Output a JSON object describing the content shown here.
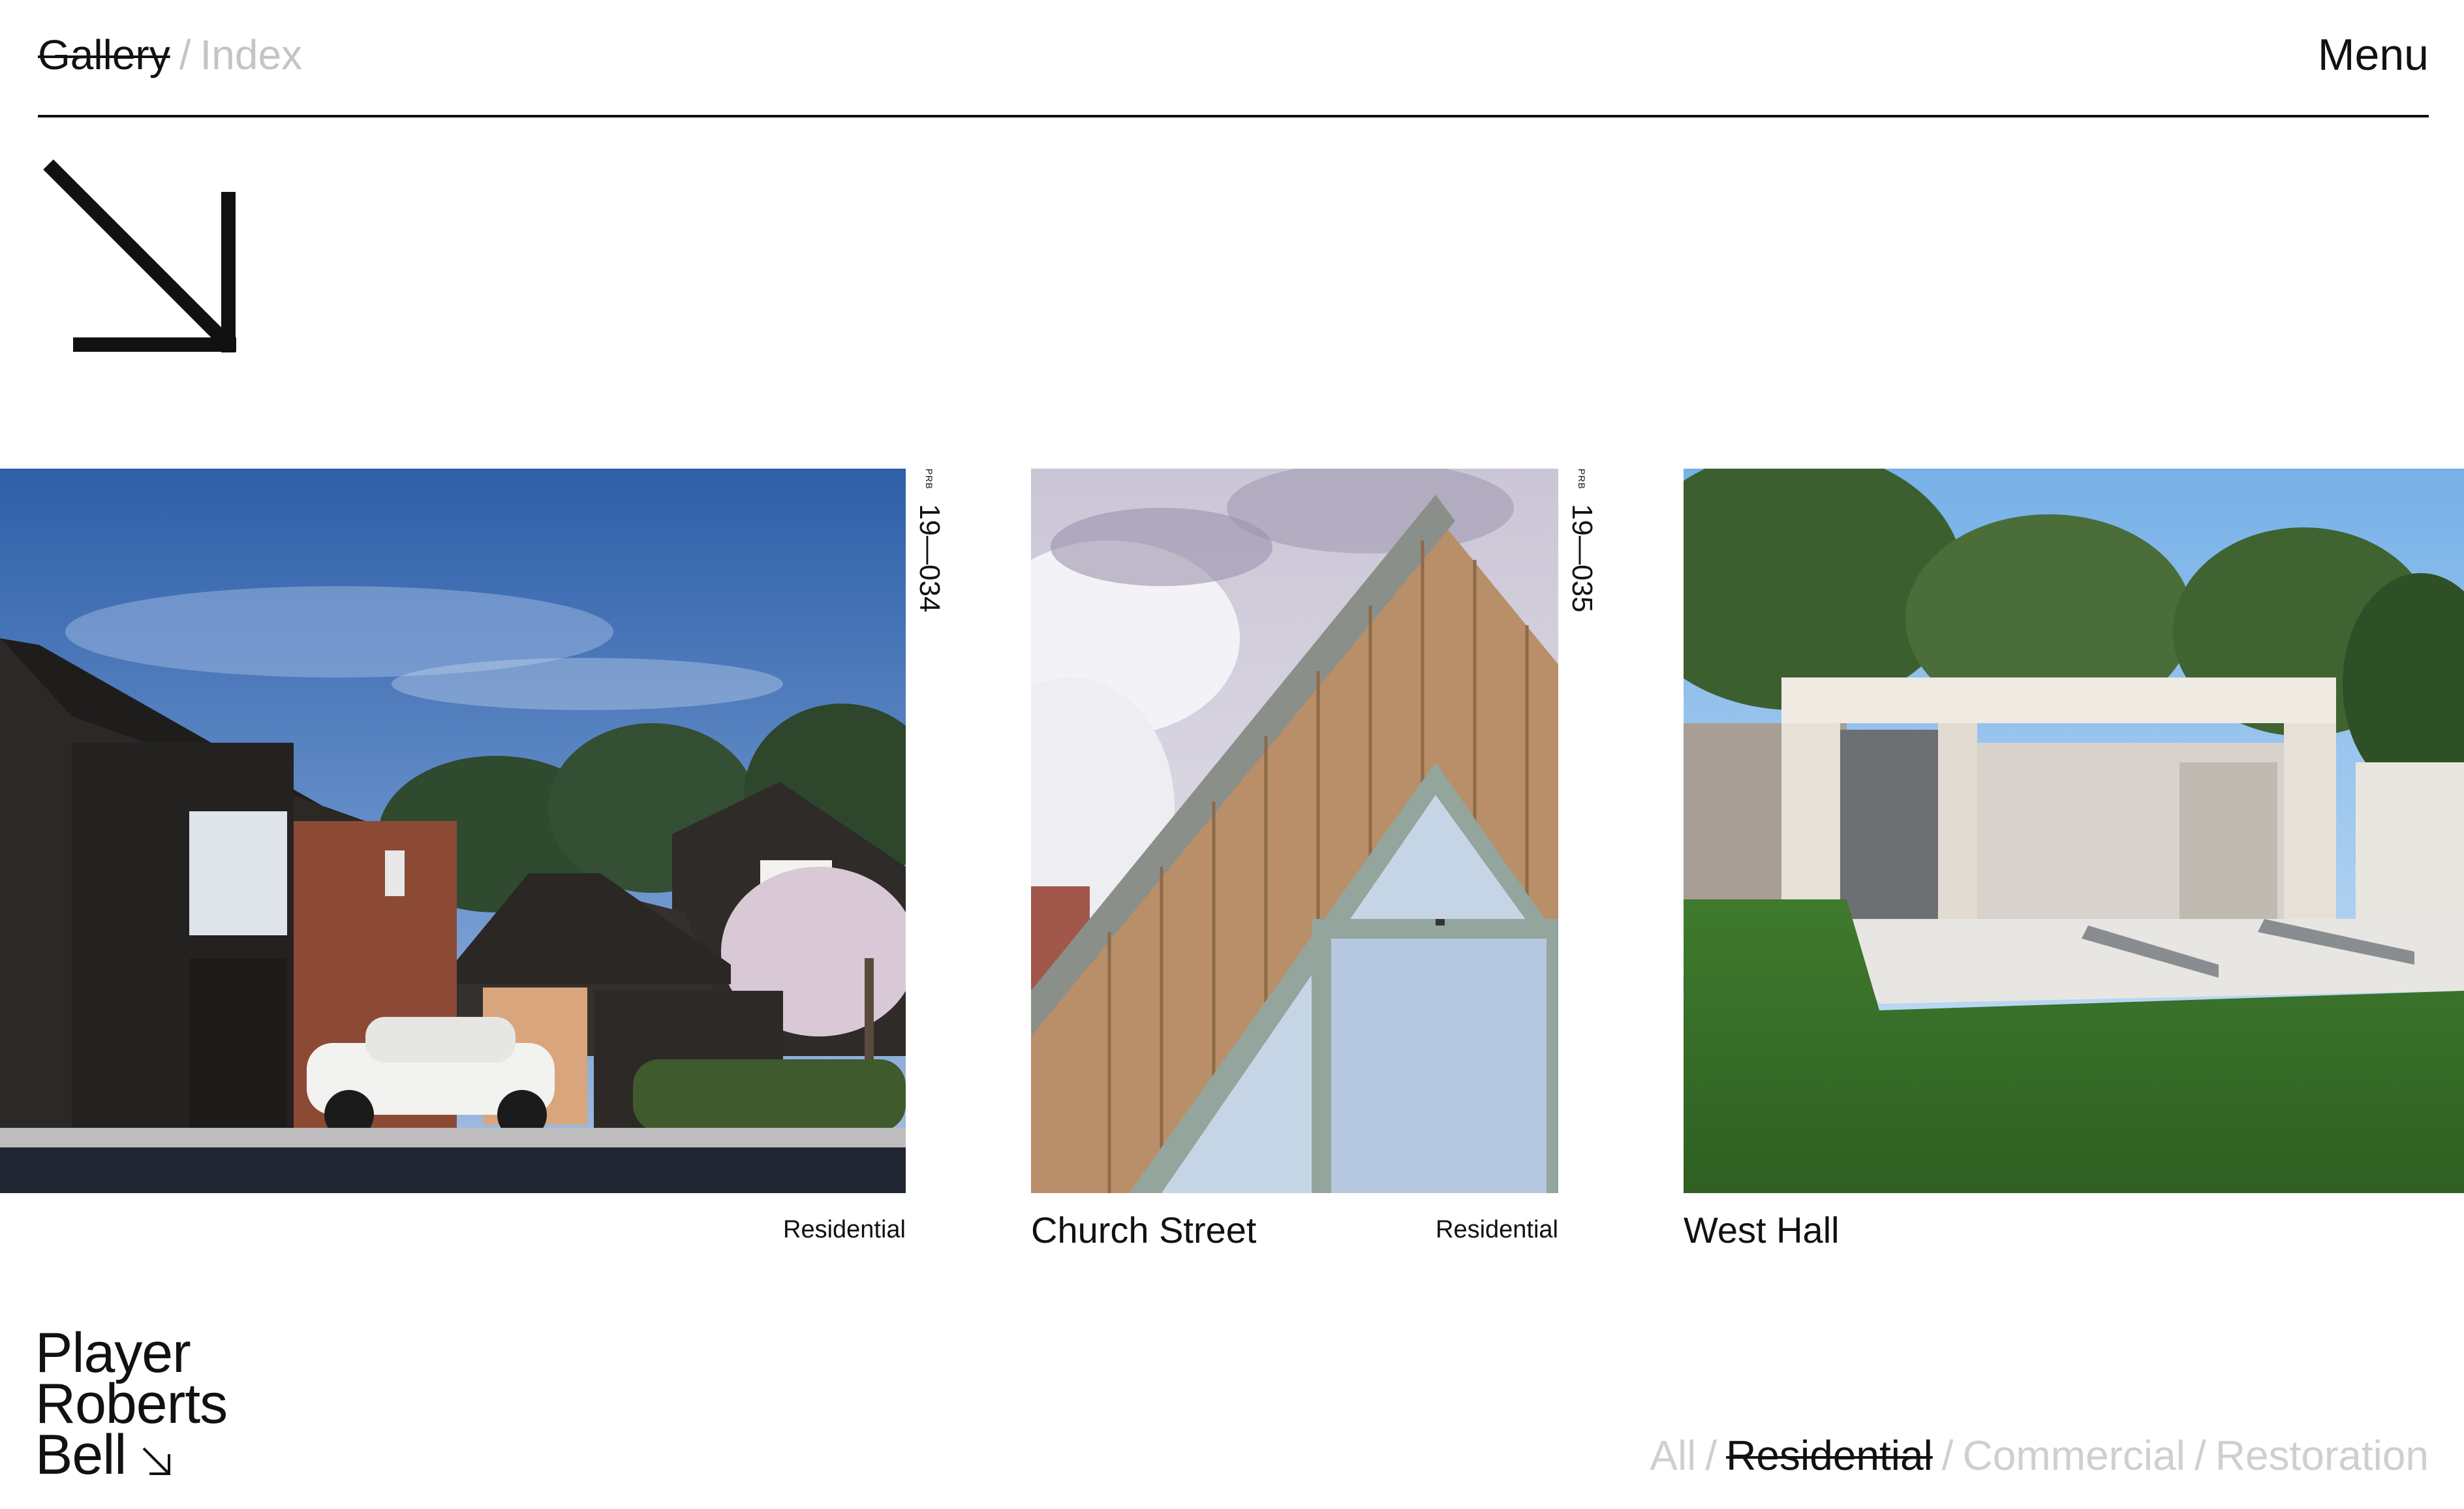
{
  "header": {
    "nav": [
      {
        "label": "Gallery",
        "active": true
      },
      {
        "label": "Index",
        "active": false
      }
    ],
    "separator": "/",
    "menu_label": "Menu"
  },
  "projects": [
    {
      "code_prefix": "PRB",
      "code": "19—034",
      "name": "",
      "category": "Residential"
    },
    {
      "code_prefix": "PRB",
      "code": "19—035",
      "name": "Church Street",
      "category": "Residential"
    },
    {
      "code_prefix": "",
      "code": "",
      "name": "West Hall",
      "category": ""
    }
  ],
  "logo": {
    "lines": [
      "Player",
      "Roberts",
      "Bell"
    ]
  },
  "filters": {
    "items": [
      {
        "label": "All",
        "active": false
      },
      {
        "label": "Residential",
        "active": true
      },
      {
        "label": "Commercial",
        "active": false
      },
      {
        "label": "Restoration",
        "active": false
      }
    ],
    "separator": "/"
  },
  "colors": {
    "text": "#111111",
    "inactive": "#c4c4c4",
    "background": "#ffffff"
  },
  "icons": {
    "hero_arrow": "arrow-down-right-icon",
    "logo_arrow": "arrow-down-right-icon"
  }
}
